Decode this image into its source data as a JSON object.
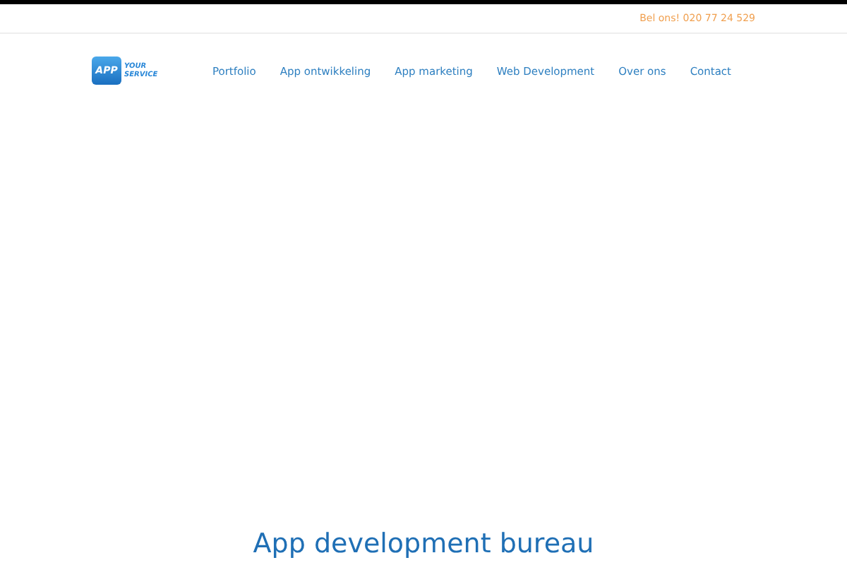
{
  "top_bar": {
    "phone": "Bel ons! 020 77 24 529"
  },
  "logo": {
    "badge": "APP",
    "line_1": "YOUR",
    "line_2": "SERVICE"
  },
  "nav": [
    "Portfolio",
    "App ontwikkeling",
    "App marketing",
    "Web Development",
    "Over ons",
    "Contact"
  ],
  "hero": {
    "heading": "App development bureau"
  }
}
